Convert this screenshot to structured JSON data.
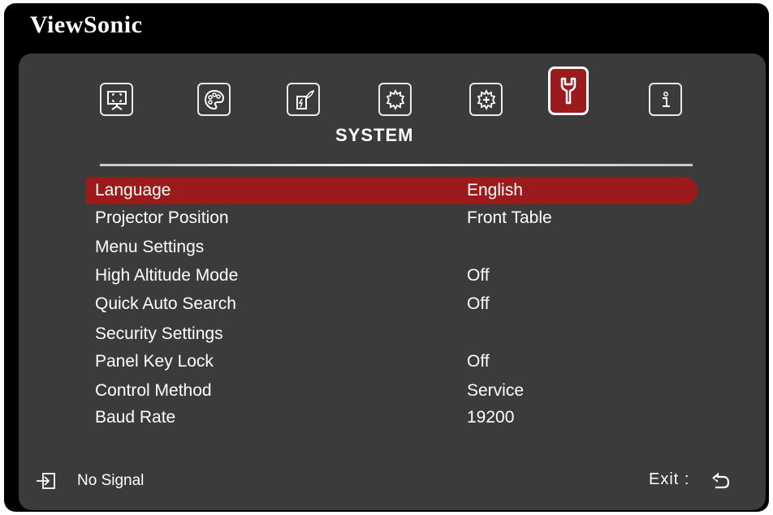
{
  "brand": "ViewSonic",
  "tabs": [
    {
      "name": "display",
      "icon": "display-icon"
    },
    {
      "name": "picture",
      "icon": "palette-icon"
    },
    {
      "name": "power",
      "icon": "power-management-icon"
    },
    {
      "name": "basic",
      "icon": "gear-icon"
    },
    {
      "name": "advanced",
      "icon": "gear-plus-icon"
    },
    {
      "name": "system",
      "icon": "wrench-icon",
      "active": true
    },
    {
      "name": "information",
      "icon": "info-icon"
    }
  ],
  "section_title": "SYSTEM",
  "menu": [
    {
      "label": "Language",
      "value": "English",
      "selected": true
    },
    {
      "label": "Projector Position",
      "value": "Front Table"
    },
    {
      "label": "Menu Settings",
      "value": ""
    },
    {
      "label": "High Altitude Mode",
      "value": "Off"
    },
    {
      "label": "Quick Auto Search",
      "value": "Off"
    },
    {
      "label": "Security Settings",
      "value": ""
    },
    {
      "label": "Panel Key Lock",
      "value": "Off"
    },
    {
      "label": "Control Method",
      "value": "Service"
    },
    {
      "label": "Baud Rate",
      "value": "19200"
    }
  ],
  "footer": {
    "signal_text": "No Signal",
    "exit_text": "Exit :"
  },
  "colors": {
    "accent": "#9b1a1c",
    "panel": "#3b3b3b",
    "frame": "#000000"
  }
}
